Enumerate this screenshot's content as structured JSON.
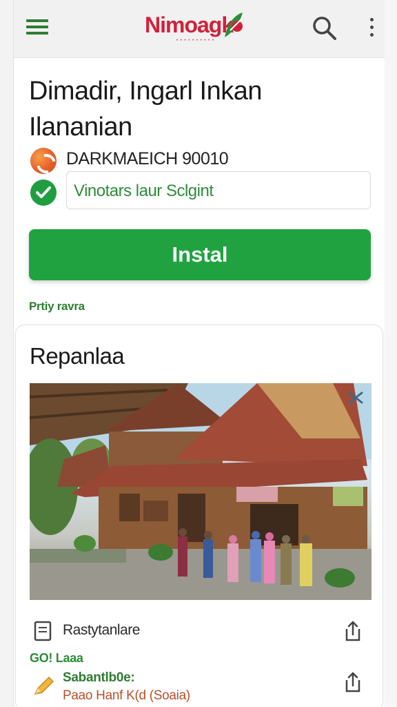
{
  "header": {
    "logo_text": "Nimoagk",
    "menu_icon": "hamburger-menu-icon",
    "search_icon": "search-icon",
    "more_icon": "more-vertical-icon"
  },
  "app": {
    "title_line1": "Dimadir, Ingarl Inkan",
    "title_line2": "Ilananian",
    "developer": "DARKMAEICH 90010",
    "developer_icon": "developer-logo-icon",
    "verified_icon": "verified-check-icon",
    "tagline": "Vinotars laur Sclgint",
    "install_label": "Instal",
    "privacy_link": "Prtiy ravra"
  },
  "card": {
    "title": "Repanlaa",
    "image_subject": "traditional-wooden-house-photo",
    "share_icon": "share-icon",
    "row1": {
      "label": "Rastytanlare",
      "icon": "document-icon",
      "action_icon": "share-upload-icon"
    },
    "section_label": "GO! Laaa",
    "row2": {
      "title": "Sabantlb0e:",
      "subtitle": "Paao Hanf K(d (Soaia)",
      "icon": "pencil-icon",
      "action_icon": "share-upload-icon"
    }
  },
  "colors": {
    "accent_green": "#20a241",
    "logo_red": "#d1213a",
    "text_dark": "#1a1a1a"
  }
}
